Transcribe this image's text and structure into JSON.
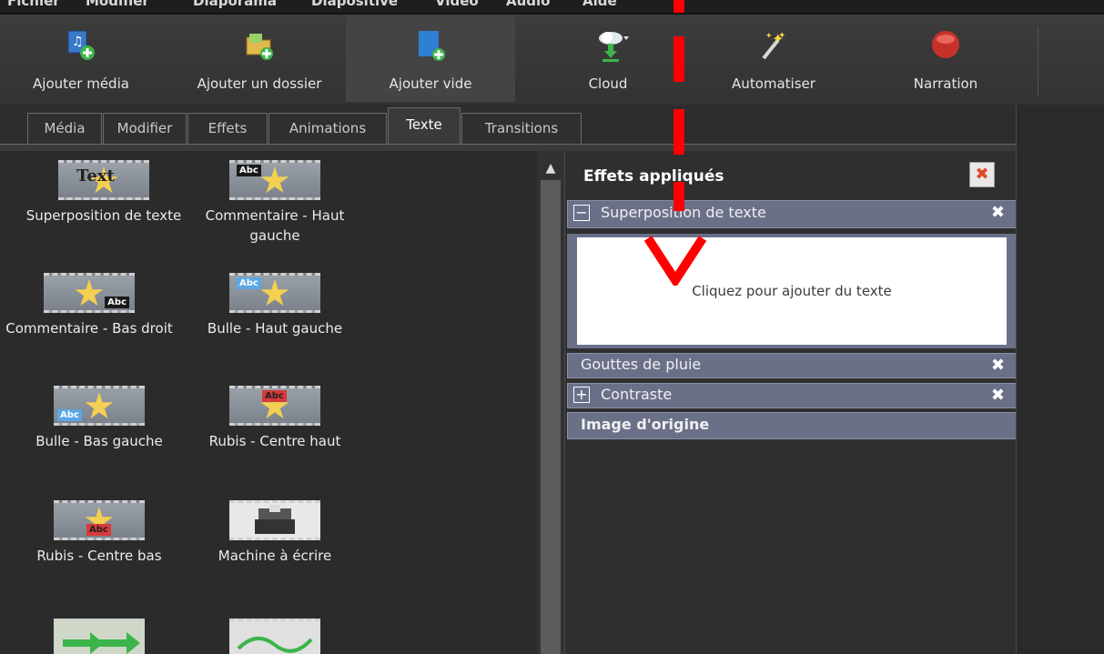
{
  "menu": {
    "items": [
      "Fichier",
      "Modifier",
      "Diaporama",
      "Diapositive",
      "Vidéo",
      "Audio",
      "Aide"
    ]
  },
  "toolbar": {
    "buttons": [
      {
        "label": "Ajouter média",
        "icon": "add-media-icon"
      },
      {
        "label": "Ajouter un dossier",
        "icon": "add-folder-icon"
      },
      {
        "label": "Ajouter vide",
        "icon": "add-empty-icon"
      },
      {
        "label": "Cloud",
        "icon": "cloud-icon"
      },
      {
        "label": "Automatiser",
        "icon": "magic-wand-icon"
      },
      {
        "label": "Narration",
        "icon": "record-icon"
      }
    ]
  },
  "tabs": [
    {
      "label": "Média"
    },
    {
      "label": "Modifier"
    },
    {
      "label": "Effets"
    },
    {
      "label": "Animations"
    },
    {
      "label": "Texte",
      "active": true
    },
    {
      "label": "Transitions"
    }
  ],
  "library": {
    "items": [
      {
        "label": "Superposition de texte",
        "badge": "Text"
      },
      {
        "label": "Commentaire - Haut gauche",
        "badge": "Abc"
      },
      {
        "label": "Commentaire - Bas droit",
        "badge": "Abc"
      },
      {
        "label": "Bulle - Haut gauche",
        "badge": "Abc"
      },
      {
        "label": "Bulle - Bas gauche",
        "badge": "Abc"
      },
      {
        "label": "Rubis - Centre haut",
        "badge": "Abc"
      },
      {
        "label": "Rubis - Centre bas",
        "badge": "Abc"
      },
      {
        "label": "Machine à écrire",
        "badge": ""
      }
    ]
  },
  "effects": {
    "title": "Effets appliqués",
    "rows": [
      {
        "name": "Superposition de texte",
        "expander": "−"
      },
      {
        "name": "Gouttes de pluie",
        "expander": ""
      },
      {
        "name": "Contraste",
        "expander": "+"
      },
      {
        "name": "Image d'origine",
        "expander": ""
      }
    ],
    "text_placeholder": "Cliquez pour ajouter du texte",
    "close_glyph": "✖",
    "remove_glyph": "✖"
  },
  "colors": {
    "accent_red": "#ff0000",
    "effect_row": "#6b7089",
    "star": "#f3cf52"
  }
}
